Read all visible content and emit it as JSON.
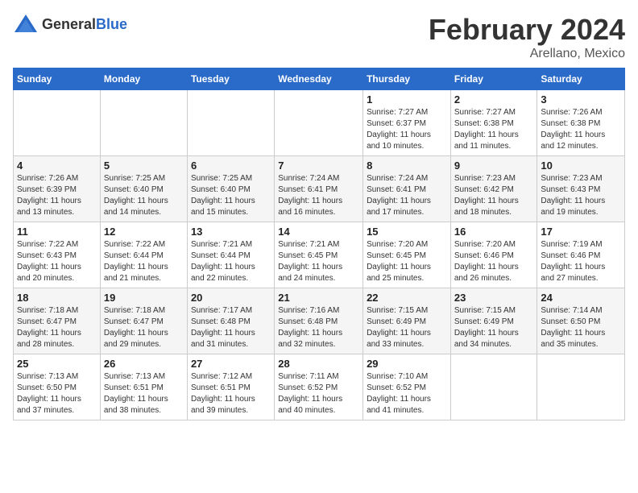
{
  "header": {
    "logo_general": "General",
    "logo_blue": "Blue",
    "title": "February 2024",
    "location": "Arellano, Mexico"
  },
  "weekdays": [
    "Sunday",
    "Monday",
    "Tuesday",
    "Wednesday",
    "Thursday",
    "Friday",
    "Saturday"
  ],
  "weeks": [
    [
      {
        "day": "",
        "info": ""
      },
      {
        "day": "",
        "info": ""
      },
      {
        "day": "",
        "info": ""
      },
      {
        "day": "",
        "info": ""
      },
      {
        "day": "1",
        "info": "Sunrise: 7:27 AM\nSunset: 6:37 PM\nDaylight: 11 hours\nand 10 minutes."
      },
      {
        "day": "2",
        "info": "Sunrise: 7:27 AM\nSunset: 6:38 PM\nDaylight: 11 hours\nand 11 minutes."
      },
      {
        "day": "3",
        "info": "Sunrise: 7:26 AM\nSunset: 6:38 PM\nDaylight: 11 hours\nand 12 minutes."
      }
    ],
    [
      {
        "day": "4",
        "info": "Sunrise: 7:26 AM\nSunset: 6:39 PM\nDaylight: 11 hours\nand 13 minutes."
      },
      {
        "day": "5",
        "info": "Sunrise: 7:25 AM\nSunset: 6:40 PM\nDaylight: 11 hours\nand 14 minutes."
      },
      {
        "day": "6",
        "info": "Sunrise: 7:25 AM\nSunset: 6:40 PM\nDaylight: 11 hours\nand 15 minutes."
      },
      {
        "day": "7",
        "info": "Sunrise: 7:24 AM\nSunset: 6:41 PM\nDaylight: 11 hours\nand 16 minutes."
      },
      {
        "day": "8",
        "info": "Sunrise: 7:24 AM\nSunset: 6:41 PM\nDaylight: 11 hours\nand 17 minutes."
      },
      {
        "day": "9",
        "info": "Sunrise: 7:23 AM\nSunset: 6:42 PM\nDaylight: 11 hours\nand 18 minutes."
      },
      {
        "day": "10",
        "info": "Sunrise: 7:23 AM\nSunset: 6:43 PM\nDaylight: 11 hours\nand 19 minutes."
      }
    ],
    [
      {
        "day": "11",
        "info": "Sunrise: 7:22 AM\nSunset: 6:43 PM\nDaylight: 11 hours\nand 20 minutes."
      },
      {
        "day": "12",
        "info": "Sunrise: 7:22 AM\nSunset: 6:44 PM\nDaylight: 11 hours\nand 21 minutes."
      },
      {
        "day": "13",
        "info": "Sunrise: 7:21 AM\nSunset: 6:44 PM\nDaylight: 11 hours\nand 22 minutes."
      },
      {
        "day": "14",
        "info": "Sunrise: 7:21 AM\nSunset: 6:45 PM\nDaylight: 11 hours\nand 24 minutes."
      },
      {
        "day": "15",
        "info": "Sunrise: 7:20 AM\nSunset: 6:45 PM\nDaylight: 11 hours\nand 25 minutes."
      },
      {
        "day": "16",
        "info": "Sunrise: 7:20 AM\nSunset: 6:46 PM\nDaylight: 11 hours\nand 26 minutes."
      },
      {
        "day": "17",
        "info": "Sunrise: 7:19 AM\nSunset: 6:46 PM\nDaylight: 11 hours\nand 27 minutes."
      }
    ],
    [
      {
        "day": "18",
        "info": "Sunrise: 7:18 AM\nSunset: 6:47 PM\nDaylight: 11 hours\nand 28 minutes."
      },
      {
        "day": "19",
        "info": "Sunrise: 7:18 AM\nSunset: 6:47 PM\nDaylight: 11 hours\nand 29 minutes."
      },
      {
        "day": "20",
        "info": "Sunrise: 7:17 AM\nSunset: 6:48 PM\nDaylight: 11 hours\nand 31 minutes."
      },
      {
        "day": "21",
        "info": "Sunrise: 7:16 AM\nSunset: 6:48 PM\nDaylight: 11 hours\nand 32 minutes."
      },
      {
        "day": "22",
        "info": "Sunrise: 7:15 AM\nSunset: 6:49 PM\nDaylight: 11 hours\nand 33 minutes."
      },
      {
        "day": "23",
        "info": "Sunrise: 7:15 AM\nSunset: 6:49 PM\nDaylight: 11 hours\nand 34 minutes."
      },
      {
        "day": "24",
        "info": "Sunrise: 7:14 AM\nSunset: 6:50 PM\nDaylight: 11 hours\nand 35 minutes."
      }
    ],
    [
      {
        "day": "25",
        "info": "Sunrise: 7:13 AM\nSunset: 6:50 PM\nDaylight: 11 hours\nand 37 minutes."
      },
      {
        "day": "26",
        "info": "Sunrise: 7:13 AM\nSunset: 6:51 PM\nDaylight: 11 hours\nand 38 minutes."
      },
      {
        "day": "27",
        "info": "Sunrise: 7:12 AM\nSunset: 6:51 PM\nDaylight: 11 hours\nand 39 minutes."
      },
      {
        "day": "28",
        "info": "Sunrise: 7:11 AM\nSunset: 6:52 PM\nDaylight: 11 hours\nand 40 minutes."
      },
      {
        "day": "29",
        "info": "Sunrise: 7:10 AM\nSunset: 6:52 PM\nDaylight: 11 hours\nand 41 minutes."
      },
      {
        "day": "",
        "info": ""
      },
      {
        "day": "",
        "info": ""
      }
    ]
  ]
}
